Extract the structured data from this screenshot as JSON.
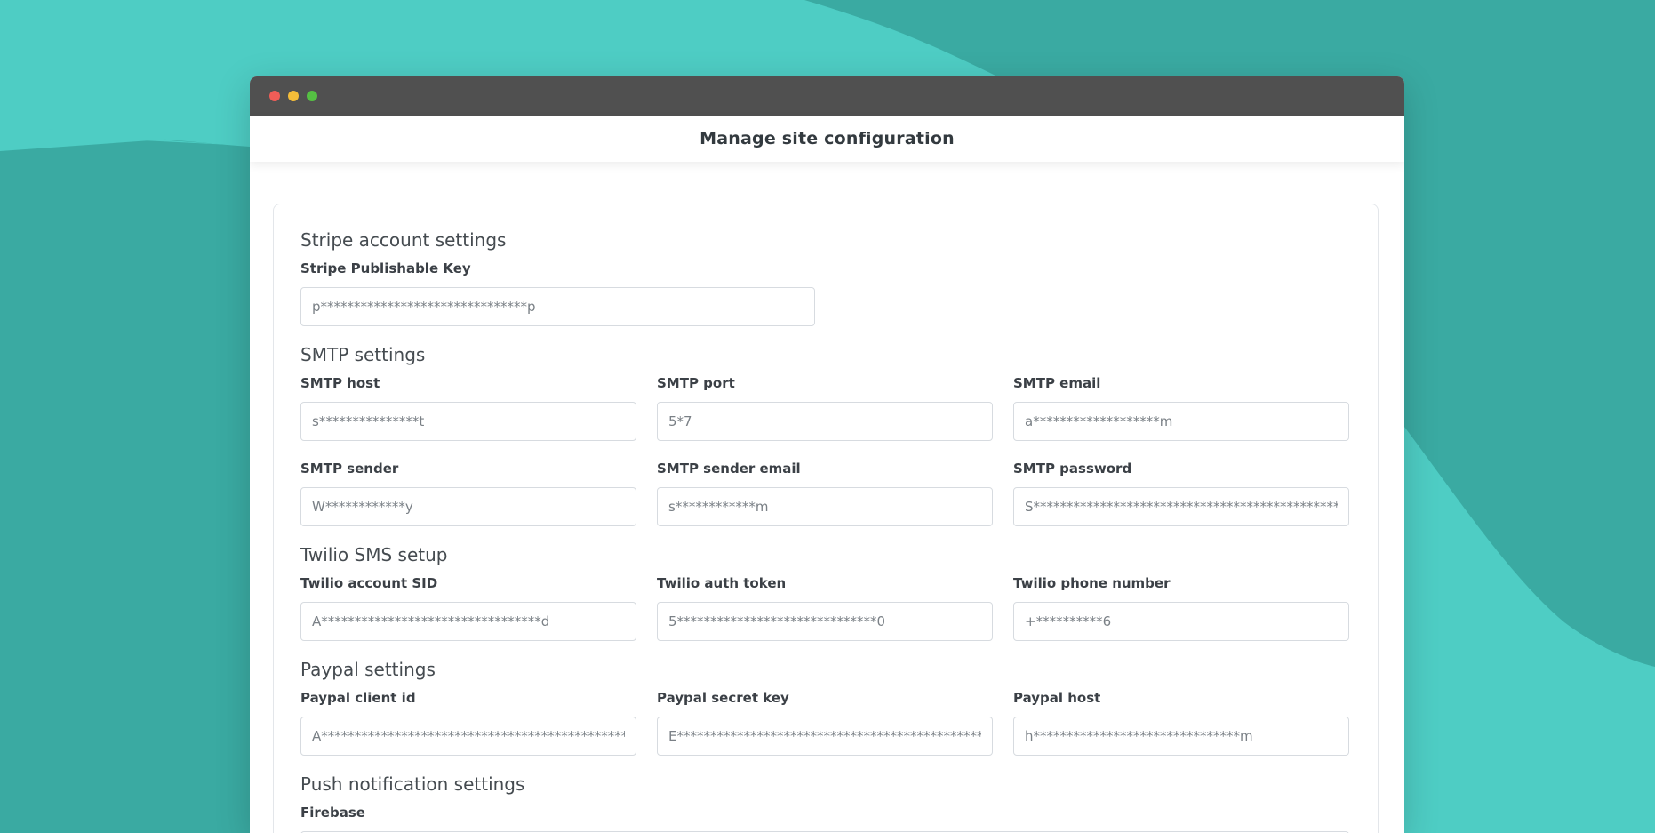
{
  "window": {
    "title": "Manage site configuration"
  },
  "sections": {
    "stripe": {
      "title": "Stripe account settings",
      "publishable_key": {
        "label": "Stripe Publishable Key",
        "value": "p*******************************p"
      }
    },
    "smtp": {
      "title": "SMTP settings",
      "host": {
        "label": "SMTP host",
        "value": "s***************t"
      },
      "port": {
        "label": "SMTP port",
        "value": "5*7"
      },
      "email": {
        "label": "SMTP email",
        "value": "a*******************m"
      },
      "sender": {
        "label": "SMTP sender",
        "value": "W************y"
      },
      "sender_email": {
        "label": "SMTP sender email",
        "value": "s************m"
      },
      "password": {
        "label": "SMTP password",
        "value": "S****************************************************************"
      }
    },
    "twilio": {
      "title": "Twilio SMS setup",
      "account_sid": {
        "label": "Twilio account SID",
        "value": "A*********************************d"
      },
      "auth_token": {
        "label": "Twilio auth token",
        "value": "5******************************0"
      },
      "phone_number": {
        "label": "Twilio phone number",
        "value": "+**********6"
      }
    },
    "paypal": {
      "title": "Paypal settings",
      "client_id": {
        "label": "Paypal client id",
        "value": "A***************************************************************"
      },
      "secret_key": {
        "label": "Paypal secret key",
        "value": "E***************************************************************"
      },
      "host": {
        "label": "Paypal host",
        "value": "h*******************************m"
      }
    },
    "push": {
      "title": "Push notification settings",
      "firebase": {
        "label": "Firebase"
      }
    }
  },
  "colors": {
    "background": "#3aaaa2",
    "background_light": "#4ecdc4",
    "titlebar": "#505050",
    "close": "#ef5d57",
    "minimize": "#f4bd39",
    "maximize": "#55c043"
  }
}
